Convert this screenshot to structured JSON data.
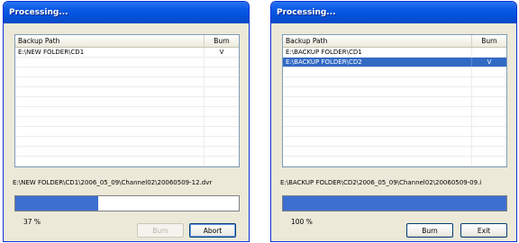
{
  "dialogs": [
    {
      "title": "Processing...",
      "columns": {
        "path": "Backup Path",
        "burn": "Burn"
      },
      "rows": [
        {
          "path": "E:\\NEW FOLDER\\CD1",
          "burn": "V",
          "selected": false
        }
      ],
      "current_file": "E:\\NEW FOLDER\\CD1\\2006_05_09\\Channel02\\20060509-12.dvr",
      "progress_percent": 37,
      "progress_label": "37  %",
      "buttons": [
        {
          "label": "Burn",
          "enabled": false
        },
        {
          "label": "Abort",
          "enabled": true
        }
      ]
    },
    {
      "title": "Processing...",
      "columns": {
        "path": "Backup Path",
        "burn": "Burn"
      },
      "rows": [
        {
          "path": "E:\\BACKUP FOLDER\\CD1",
          "burn": "",
          "selected": false
        },
        {
          "path": "E:\\BACKUP FOLDER\\CD2",
          "burn": "V",
          "selected": true
        }
      ],
      "current_file": "E:\\BACKUP FOLDER\\CD2\\2006_05_09\\Channel02\\20060509-09.i",
      "progress_percent": 100,
      "progress_label": "100  %",
      "buttons": [
        {
          "label": "Burn",
          "enabled": true
        },
        {
          "label": "Exit",
          "enabled": true
        }
      ]
    }
  ],
  "colors": {
    "title_bar": "#0a5ae6",
    "progress_fill": "#3d6fd0",
    "selection": "#316ac5",
    "dialog_face": "#ece9d8"
  }
}
